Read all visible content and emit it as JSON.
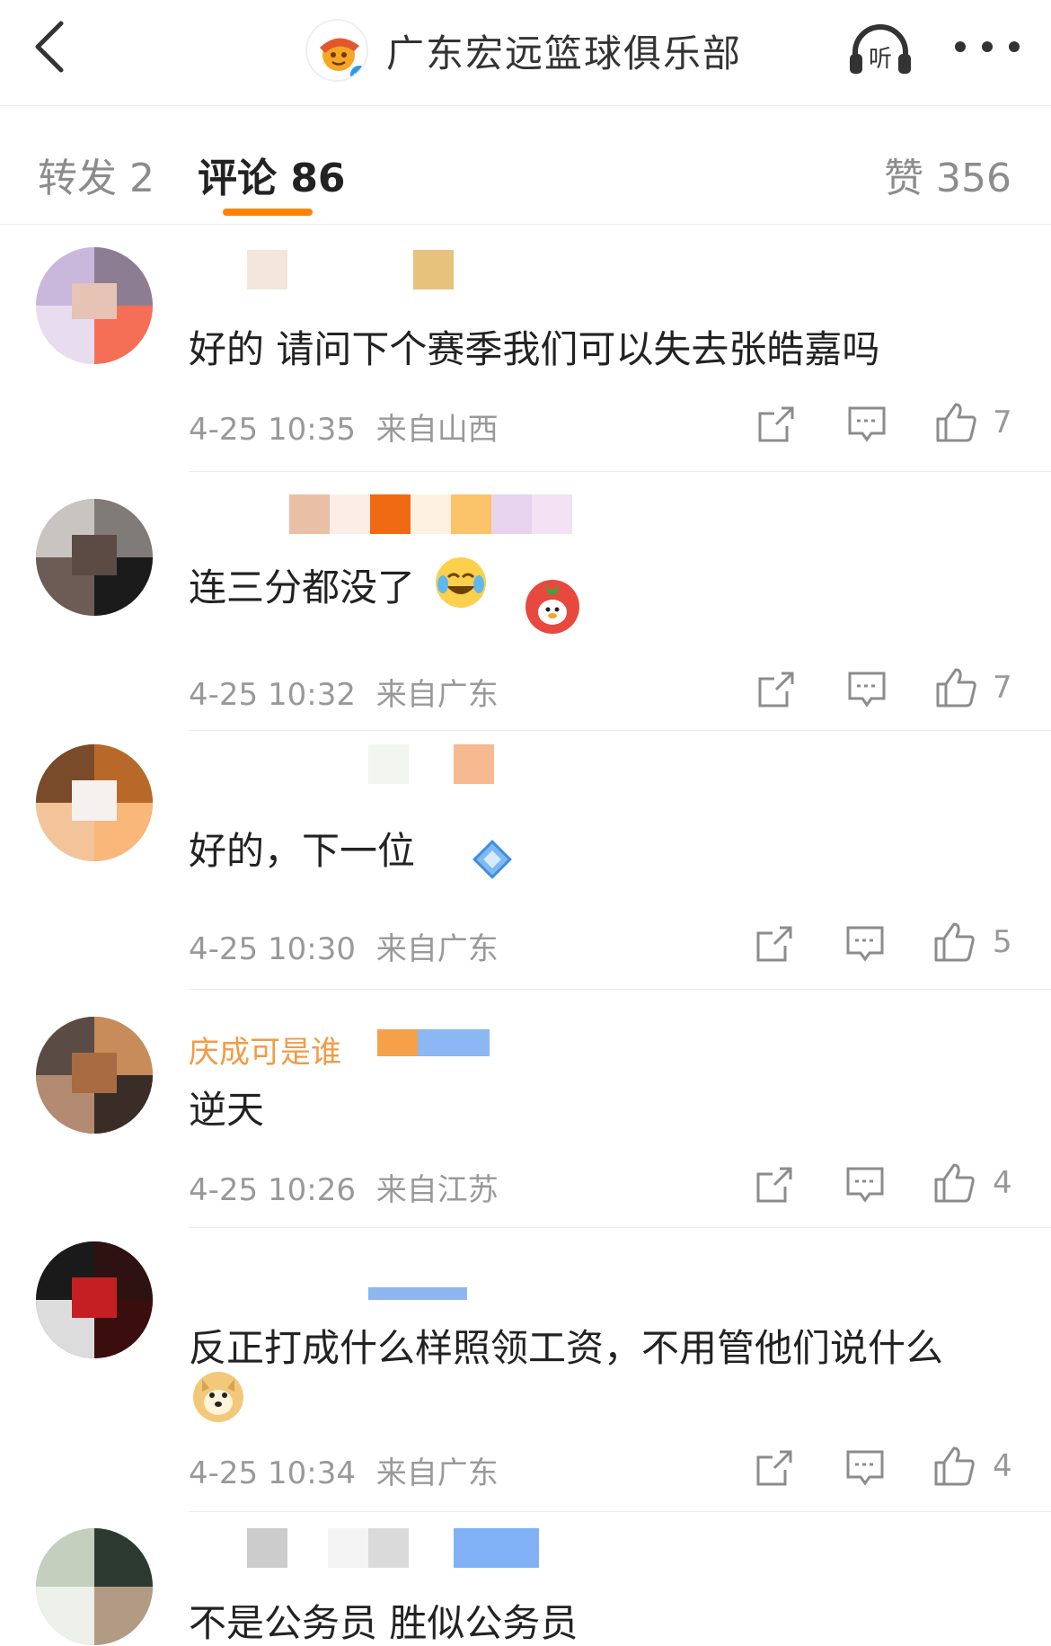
{
  "header": {
    "title": "广东宏远篮球俱乐部",
    "listen_label": "听"
  },
  "tabs": {
    "repost": "转发 2",
    "comment": "评论 86",
    "like": "赞 356"
  },
  "colors": {
    "accent": "#ff8200",
    "verified": "#2a9ae8",
    "meta": "#999999"
  },
  "comments": [
    {
      "text": "好的 请问下个赛季我们可以失去张皓嘉吗",
      "time": "4-25 10:35",
      "location": "来自山西",
      "likes": "7"
    },
    {
      "text": "连三分都没了",
      "time": "4-25 10:32",
      "location": "来自广东",
      "likes": "7"
    },
    {
      "text": "好的，下一位",
      "time": "4-25 10:30",
      "location": "来自广东",
      "likes": "5"
    },
    {
      "username": "庆成可是谁",
      "text": "逆天",
      "time": "4-25 10:26",
      "location": "来自江苏",
      "likes": "4"
    },
    {
      "text": "反正打成什么样照领工资，不用管他们说什么",
      "time": "4-25 10:34",
      "location": "来自广东",
      "likes": "4"
    },
    {
      "text": "不是公务员 胜似公务员"
    }
  ]
}
